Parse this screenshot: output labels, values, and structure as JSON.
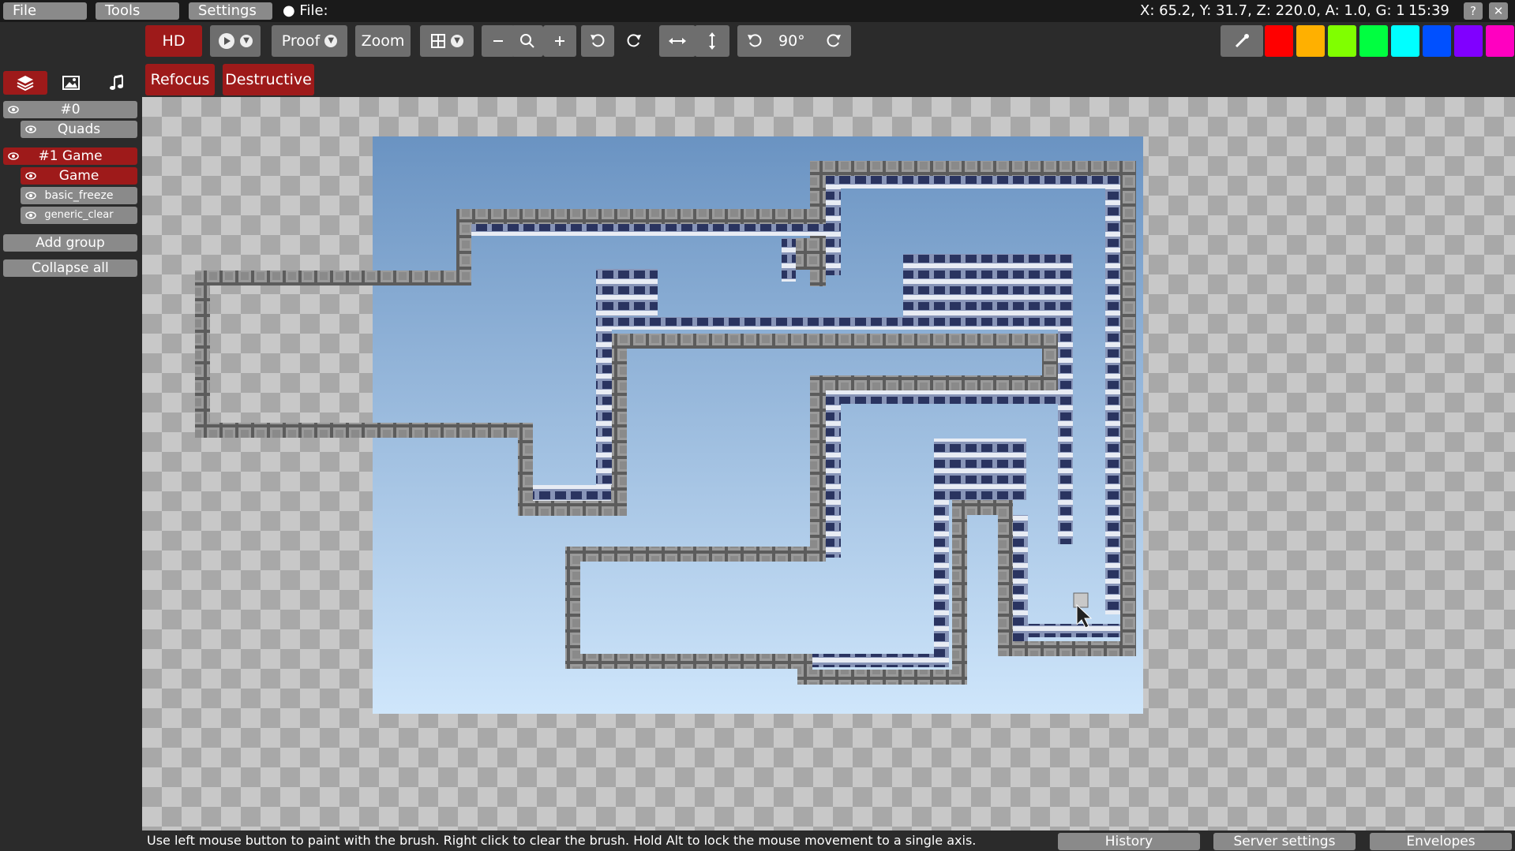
{
  "menu": {
    "file": "File",
    "tools": "Tools",
    "settings": "Settings",
    "file_status": "● File:"
  },
  "status_bar": {
    "coords": "X: 65.2, Y: 31.7, Z: 220.0, A: 1.0, G: 1",
    "time": "15:39",
    "help": "?",
    "close": "✕"
  },
  "toolbar": {
    "hd": "HD",
    "proof": "Proof",
    "zoom": "Zoom",
    "rotate_angle": "90°",
    "refocus": "Refocus",
    "destructive": "Destructive"
  },
  "icons": [
    "play-icon",
    "grid-icon",
    "zoom-out-icon",
    "zoom-reset-icon",
    "zoom-in-icon",
    "undo-icon",
    "redo-icon",
    "flip-horizontal-icon",
    "flip-vertical-icon",
    "rotate-ccw-icon",
    "rotate-cw-icon",
    "color-picker-icon",
    "layers-icon",
    "image-icon",
    "sound-icon",
    "eye-icon",
    "cursor-icon"
  ],
  "colors": {
    "accent_red": "#9e1a1a",
    "swatches": [
      "#ff0000",
      "#ffb000",
      "#80ff00",
      "#00ff40",
      "#00ffff",
      "#0050ff",
      "#8000ff",
      "#ff00c0"
    ]
  },
  "sidebar": {
    "groups": [
      {
        "label": "#0",
        "layers": [
          {
            "label": "Quads"
          }
        ]
      },
      {
        "label": "#1 Game",
        "layers": [
          {
            "label": "Game"
          },
          {
            "label": "basic_freeze"
          },
          {
            "label": "generic_clear"
          }
        ]
      }
    ],
    "add_group": "Add group",
    "collapse_all": "Collapse all"
  },
  "footer": {
    "hint": "Use left mouse button to paint with the brush. Right click to clear the brush. Hold Alt to lock the mouse movement to a single axis.",
    "history": "History",
    "server_settings": "Server settings",
    "envelopes": "Envelopes"
  }
}
